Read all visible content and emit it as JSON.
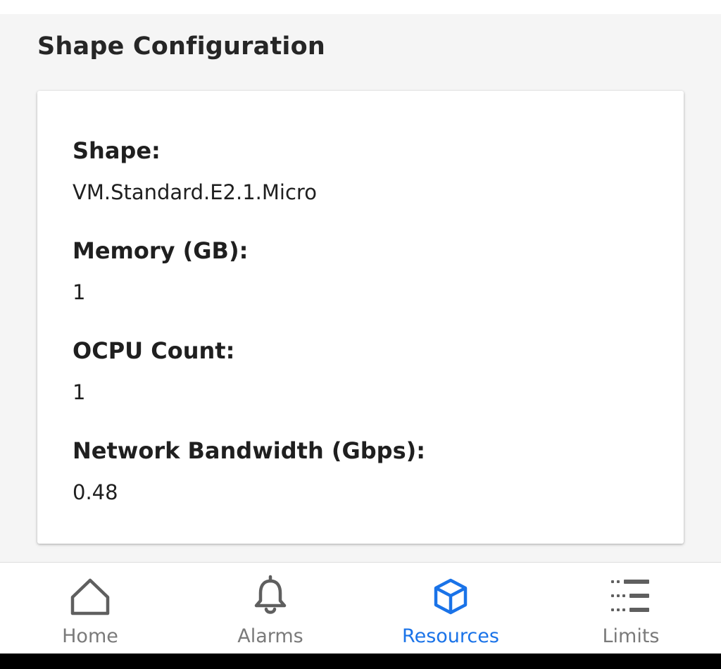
{
  "section": {
    "title": "Shape Configuration"
  },
  "fields": [
    {
      "label": "Shape:",
      "value": "VM.Standard.E2.1.Micro"
    },
    {
      "label": "Memory (GB):",
      "value": "1"
    },
    {
      "label": "OCPU Count:",
      "value": "1"
    },
    {
      "label": "Network Bandwidth (Gbps):",
      "value": "0.48"
    }
  ],
  "bottom_nav": {
    "items": [
      {
        "label": "Home",
        "icon": "home-icon",
        "active": false
      },
      {
        "label": "Alarms",
        "icon": "bell-icon",
        "active": false
      },
      {
        "label": "Resources",
        "icon": "cube-icon",
        "active": true
      },
      {
        "label": "Limits",
        "icon": "list-icon",
        "active": false
      }
    ]
  },
  "colors": {
    "accent": "#1a73e8",
    "inactive_nav": "#7a7a7a",
    "text": "#1f1f1f",
    "page_background": "#f5f5f5",
    "card_background": "#ffffff"
  }
}
